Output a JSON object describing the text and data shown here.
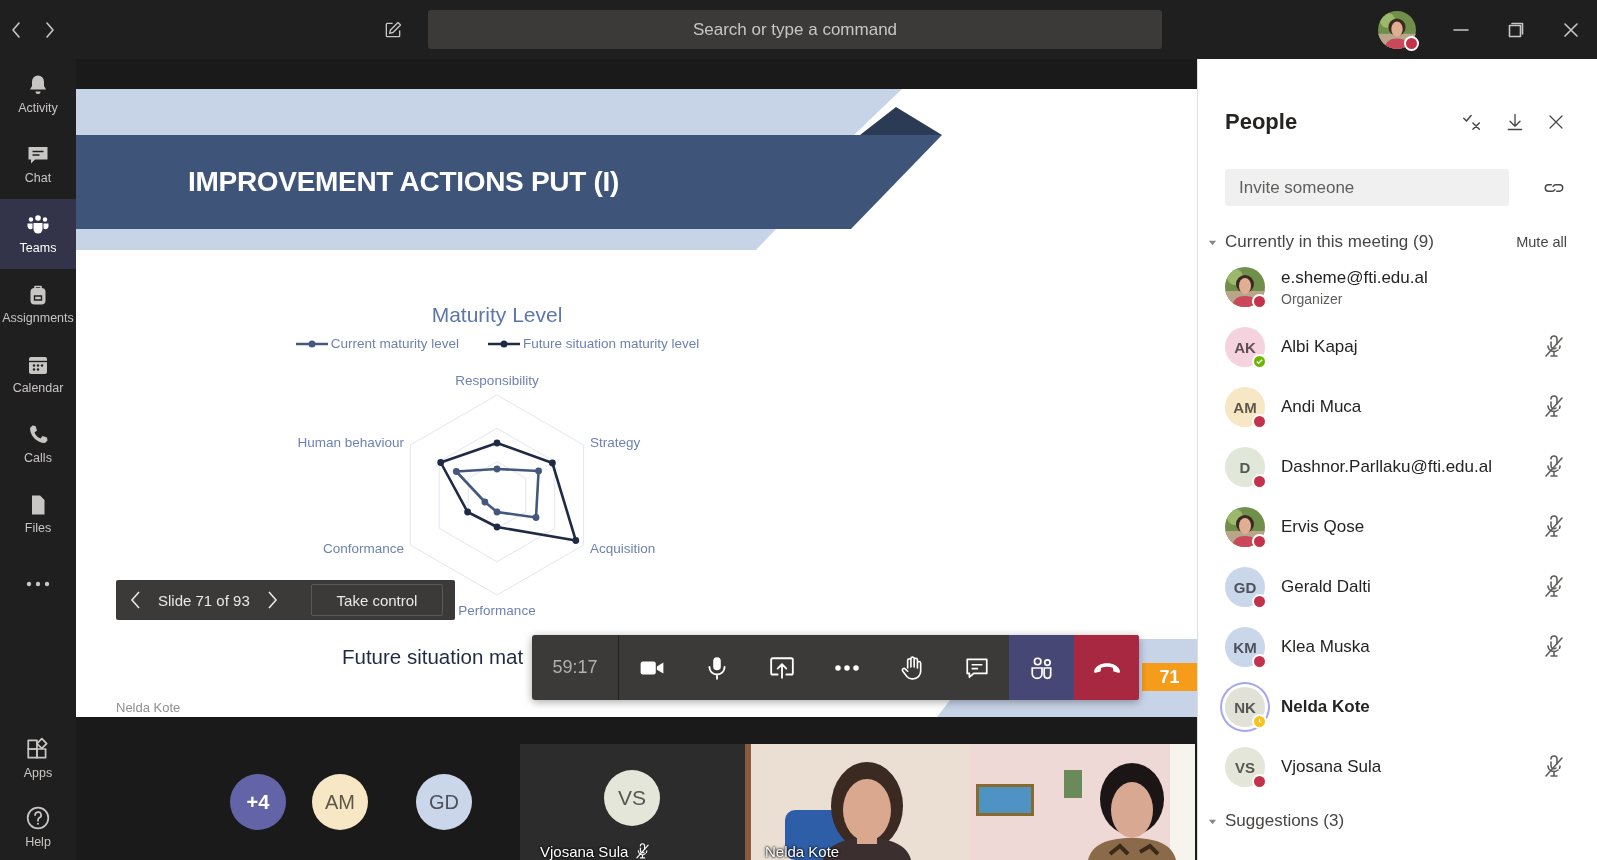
{
  "topbar": {
    "search": {
      "placeholder": "Search or type a command"
    },
    "account": {
      "status": {
        "kind": "busy",
        "color": "#c4314b"
      }
    }
  },
  "app_bar": {
    "items": [
      {
        "label": "Activity",
        "selected": false
      },
      {
        "label": "Chat",
        "selected": false
      },
      {
        "label": "Teams",
        "selected": true
      },
      {
        "label": "Assignments",
        "selected": false
      },
      {
        "label": "Calendar",
        "selected": false
      },
      {
        "label": "Calls",
        "selected": false
      },
      {
        "label": "Files",
        "selected": false
      }
    ],
    "bottom_items": [
      {
        "label": "Apps",
        "selected": false
      },
      {
        "label": "Help",
        "selected": false
      }
    ]
  },
  "slide": {
    "title": "IMPROVEMENT ACTIONS PUT (I)",
    "chart": {
      "title": "Maturity Level",
      "legend": [
        {
          "label": "Current maturity level",
          "color": "#44587e"
        },
        {
          "label": "Future situation maturity level",
          "color": "#1f2b45"
        }
      ],
      "axes": [
        "Responsibility",
        "Strategy",
        "Acquisition",
        "Performance",
        "Conformance",
        "Human behaviour"
      ]
    },
    "caption": "Future situation mat",
    "slide_number": "71",
    "presenter": "Nelda Kote"
  },
  "slide_controls": {
    "counter": "Slide 71 of 93",
    "take_control": "Take control"
  },
  "call_controls": {
    "timer": "59:17",
    "buttons": [
      {
        "kind": "camera",
        "selected": false
      },
      {
        "kind": "mic",
        "selected": false
      },
      {
        "kind": "share",
        "selected": false
      },
      {
        "kind": "more",
        "selected": false
      },
      {
        "kind": "hand",
        "selected": false
      },
      {
        "kind": "chat",
        "selected": false
      },
      {
        "kind": "participants",
        "selected": true
      },
      {
        "kind": "hangup"
      }
    ]
  },
  "gallery": {
    "overflow": "+4",
    "avatars": [
      {
        "initials": "AM",
        "color": "#f8e7c4"
      },
      {
        "initials": "GD",
        "color": "#cad6ea"
      }
    ],
    "tiles": [
      {
        "kind": "avatar",
        "initials": "VS",
        "color": "#e3e6d8",
        "name": "Vjosana Sula",
        "muted": true
      },
      {
        "kind": "video",
        "name": "Nelda Kote"
      },
      {
        "kind": "video"
      }
    ]
  },
  "people": {
    "title": "People",
    "invite": {
      "placeholder": "Invite someone"
    },
    "sections": [
      {
        "label": "Currently in this meeting (9)",
        "expanded": true,
        "action": "Mute all",
        "people": [
          {
            "name": "e.sheme@fti.edu.al",
            "role": "Organizer",
            "status": {
              "kind": "busy",
              "color": "#c4314b"
            },
            "muted": false,
            "speaking": false
          },
          {
            "name": "Albi Kapaj",
            "avatar": {
              "kind": "initials",
              "initials": "AK",
              "color": "#f4d3de"
            },
            "status": {
              "kind": "available",
              "color": "#6bb700"
            },
            "muted": true,
            "speaking": false
          },
          {
            "name": "Andi Muca",
            "avatar": {
              "kind": "initials",
              "initials": "AM",
              "color": "#f8e7c4"
            },
            "status": {
              "kind": "busy",
              "color": "#c4314b"
            },
            "muted": true,
            "speaking": false
          },
          {
            "name": "Dashnor.Parllaku@fti.edu.al",
            "avatar": {
              "kind": "initials",
              "initials": "D",
              "color": "#e1e8da"
            },
            "status": {
              "kind": "busy",
              "color": "#c4314b"
            },
            "muted": true,
            "speaking": false
          },
          {
            "name": "Ervis Qose",
            "status": {
              "kind": "busy",
              "color": "#c4314b"
            },
            "muted": true,
            "speaking": false
          },
          {
            "name": "Gerald Dalti",
            "avatar": {
              "kind": "initials",
              "initials": "GD",
              "color": "#cad6ea"
            },
            "status": {
              "kind": "busy",
              "color": "#c4314b"
            },
            "muted": true,
            "speaking": false
          },
          {
            "name": "Klea Muska",
            "avatar": {
              "kind": "initials",
              "initials": "KM",
              "color": "#cad6ea"
            },
            "status": {
              "kind": "busy",
              "color": "#c4314b"
            },
            "muted": true,
            "speaking": false
          },
          {
            "name": "Nelda Kote",
            "avatar": {
              "kind": "initials",
              "initials": "NK",
              "color": "#e1e1d8"
            },
            "status": {
              "kind": "away",
              "color": "#f8c21a"
            },
            "muted": false,
            "speaking": true
          },
          {
            "name": "Vjosana Sula",
            "avatar": {
              "kind": "initials",
              "initials": "VS",
              "color": "#e3e6d8"
            },
            "status": {
              "kind": "busy",
              "color": "#c4314b"
            },
            "muted": true,
            "speaking": false
          }
        ]
      },
      {
        "label": "Suggestions (3)",
        "expanded": true
      }
    ]
  }
}
